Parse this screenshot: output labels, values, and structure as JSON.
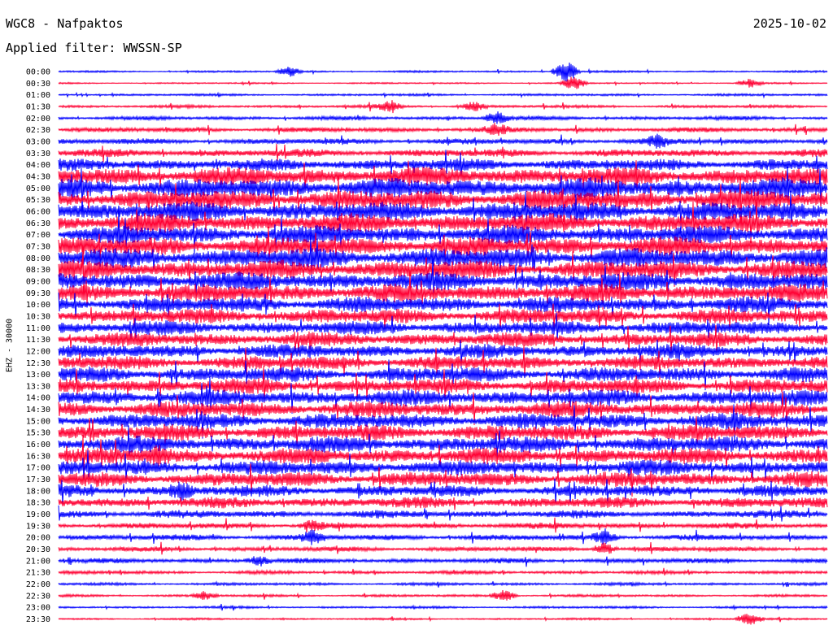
{
  "header": {
    "station": "WGC8 - Nafpaktos",
    "filter": "Applied filter: WWSSN-SP",
    "date": "2025-10-02"
  },
  "channel_label": "EHZ - 30000",
  "colors": {
    "trace_a": "#0000ff",
    "trace_b": "#ff0033",
    "background": "#ffffff",
    "text": "#000000"
  },
  "chart_data": {
    "type": "line",
    "subtype": "helicorder",
    "row_interval_minutes": 30,
    "row_labels": [
      "00:00",
      "00:30",
      "01:00",
      "01:30",
      "02:00",
      "02:30",
      "03:00",
      "03:30",
      "04:00",
      "04:30",
      "05:00",
      "05:30",
      "06:00",
      "06:30",
      "07:00",
      "07:30",
      "08:00",
      "08:30",
      "09:00",
      "09:30",
      "10:00",
      "10:30",
      "11:00",
      "11:30",
      "12:00",
      "12:30",
      "13:00",
      "13:30",
      "14:00",
      "14:30",
      "15:00",
      "15:30",
      "16:00",
      "16:30",
      "17:00",
      "17:30",
      "18:00",
      "18:30",
      "19:00",
      "19:30",
      "20:00",
      "20:30",
      "21:00",
      "21:30",
      "22:00",
      "22:30",
      "23:00",
      "23:30"
    ],
    "series": [
      {
        "color": "#0000ff",
        "rows": "even"
      },
      {
        "color": "#ff0033",
        "rows": "odd"
      }
    ],
    "noise_level": [
      1.0,
      0.8,
      1.2,
      1.5,
      2.0,
      2.5,
      3.0,
      4.0,
      6.0,
      9.0,
      10.0,
      10.0,
      9.5,
      9.5,
      9.0,
      9.5,
      10.0,
      9.5,
      9.0,
      9.0,
      8.0,
      7.5,
      7.0,
      7.0,
      7.0,
      7.0,
      7.5,
      7.5,
      8.0,
      8.0,
      8.0,
      8.0,
      8.0,
      8.0,
      7.5,
      7.5,
      6.0,
      5.5,
      4.0,
      3.0,
      3.0,
      2.5,
      2.5,
      1.8,
      1.5,
      1.3,
      1.2,
      1.0
    ],
    "events": [
      {
        "row": 0,
        "position": 0.3,
        "amplitude": 6
      },
      {
        "row": 0,
        "position": 0.66,
        "amplitude": 16
      },
      {
        "row": 1,
        "position": 0.67,
        "amplitude": 8
      },
      {
        "row": 1,
        "position": 0.9,
        "amplitude": 5
      },
      {
        "row": 3,
        "position": 0.43,
        "amplitude": 6
      },
      {
        "row": 3,
        "position": 0.54,
        "amplitude": 6
      },
      {
        "row": 4,
        "position": 0.57,
        "amplitude": 8
      },
      {
        "row": 5,
        "position": 0.57,
        "amplitude": 6
      },
      {
        "row": 6,
        "position": 0.78,
        "amplitude": 6
      },
      {
        "row": 33,
        "position": 0.13,
        "amplitude": 8
      },
      {
        "row": 36,
        "position": 0.16,
        "amplitude": 8
      },
      {
        "row": 39,
        "position": 0.33,
        "amplitude": 6
      },
      {
        "row": 40,
        "position": 0.33,
        "amplitude": 7
      },
      {
        "row": 40,
        "position": 0.71,
        "amplitude": 7
      },
      {
        "row": 41,
        "position": 0.71,
        "amplitude": 7
      },
      {
        "row": 42,
        "position": 0.26,
        "amplitude": 6
      },
      {
        "row": 45,
        "position": 0.19,
        "amplitude": 5
      },
      {
        "row": 45,
        "position": 0.58,
        "amplitude": 7
      },
      {
        "row": 47,
        "position": 0.9,
        "amplitude": 8
      }
    ]
  }
}
